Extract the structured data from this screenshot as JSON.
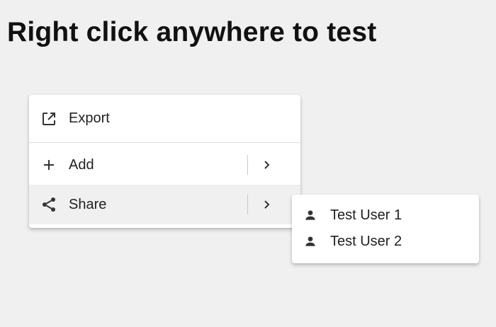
{
  "page": {
    "title": "Right click anywhere to test"
  },
  "context_menu": {
    "items": [
      {
        "label": "Export",
        "icon": "open-in-new-icon",
        "has_submenu": false
      },
      {
        "label": "Add",
        "icon": "plus-icon",
        "has_submenu": true
      },
      {
        "label": "Share",
        "icon": "share-icon",
        "has_submenu": true,
        "highlighted": true
      }
    ]
  },
  "submenu": {
    "parent": "Share",
    "items": [
      {
        "label": "Test User 1",
        "icon": "person-icon"
      },
      {
        "label": "Test User 2",
        "icon": "person-icon"
      }
    ]
  },
  "colors": {
    "background": "#f0f0f0",
    "menu_background": "#ffffff",
    "highlight": "#f0f0f0",
    "text": "#212121",
    "icon": "#333333"
  }
}
